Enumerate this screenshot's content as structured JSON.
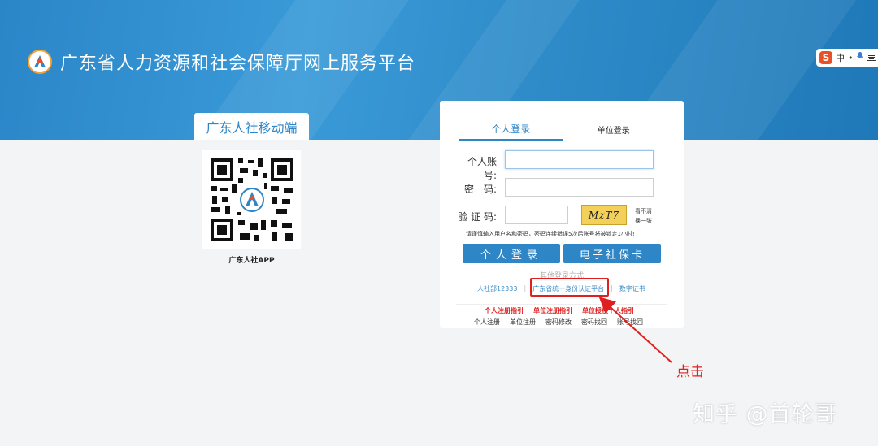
{
  "header": {
    "site_title": "广东省人力资源和社会保障厅网上服务平台",
    "ime": {
      "mode": "中",
      "punct": "•",
      "mic": "🎤",
      "keyboard": "⌨"
    }
  },
  "mobile_app": {
    "tab_label": "广东人社移动端",
    "caption": "广东人社APP"
  },
  "login": {
    "tabs": [
      {
        "label": "个人登录",
        "active": true
      },
      {
        "label": "单位登录",
        "active": false
      }
    ],
    "account_label": "个人账号:",
    "password_label": "密　码:",
    "captcha_label": "验 证 码:",
    "account_value": "",
    "password_value": "",
    "captcha_value": "",
    "captcha_text": "MzT7",
    "refresh_line1": "看不清",
    "refresh_line2": "换一张",
    "warning": "请谨慎输入用户名和密码，密码连续错误5次后账号将被锁定1小时!",
    "personal_login_button": "个人登录",
    "social_card_button": "电子社保卡",
    "other_methods_title": "其他登录方式",
    "other_methods": [
      "人社部12333",
      "广东省统一身份认证平台",
      "数字证书"
    ],
    "guides": [
      "个人注册指引",
      "单位注册指引",
      "单位授权个人指引"
    ],
    "bottom_links": [
      "个人注册",
      "单位注册",
      "密码修改",
      "密码找回",
      "账号找回"
    ]
  },
  "annotation": {
    "click_label": "点击",
    "color": "#e02020"
  },
  "watermark": "知乎 @首轮哥",
  "colors": {
    "brand_blue": "#2f86c6",
    "banner_blue": "#2b86c8",
    "alert_red": "#e02020"
  }
}
